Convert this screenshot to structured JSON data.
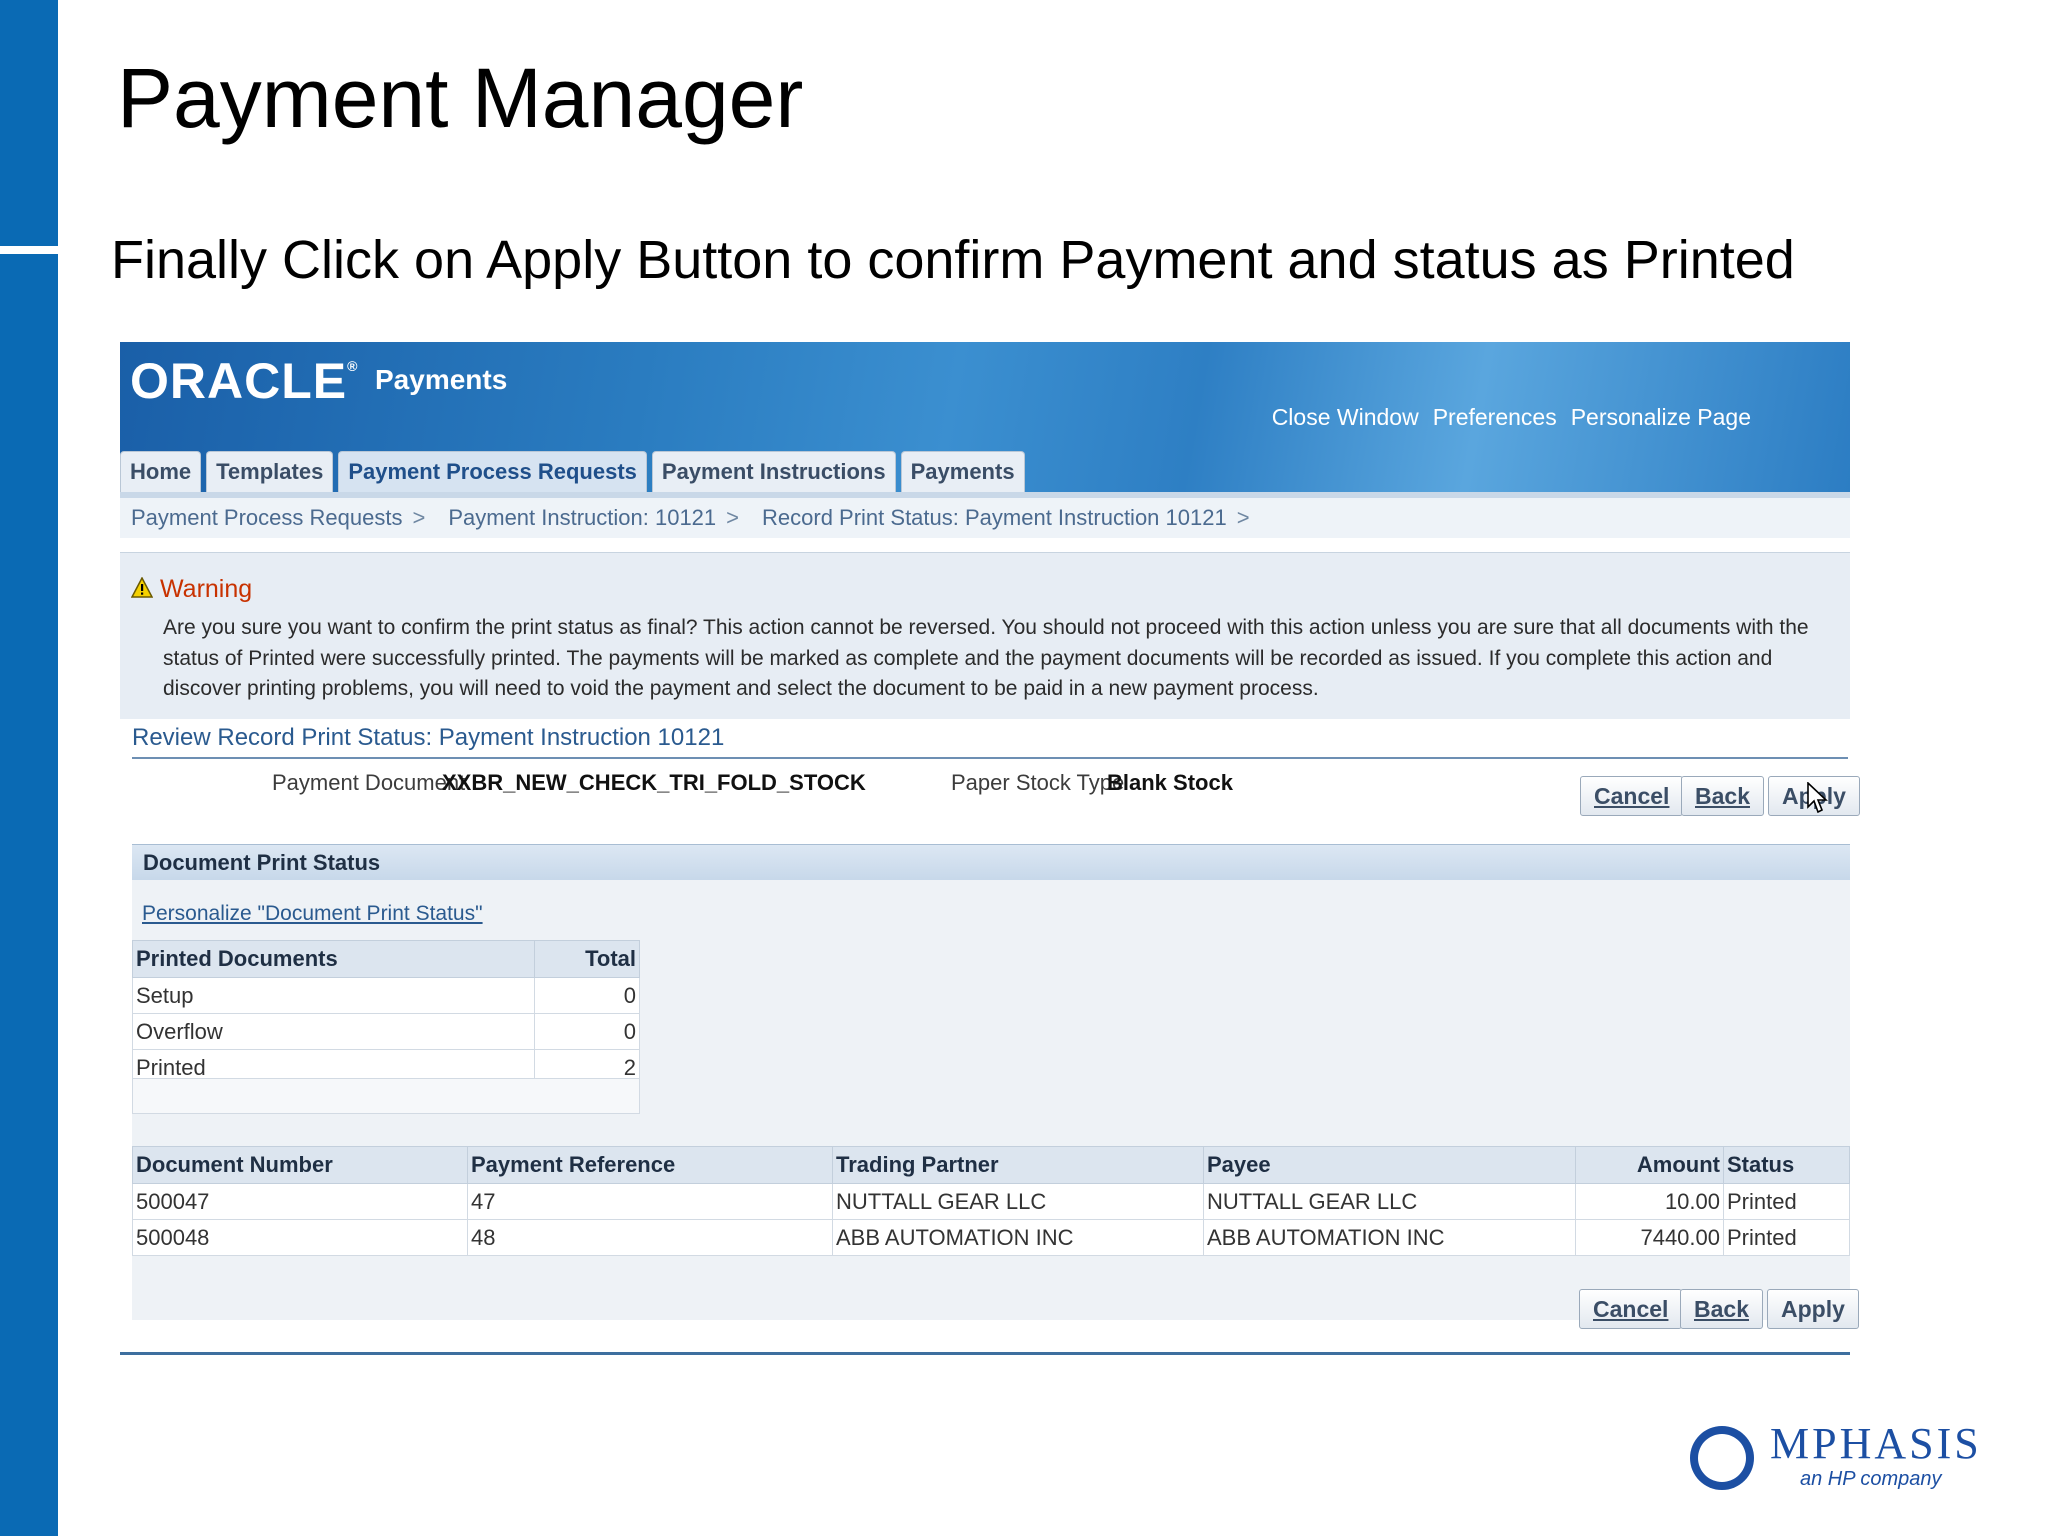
{
  "slide": {
    "title": "Payment Manager",
    "subtitle": "Finally Click on Apply Button to confirm Payment and status as Printed"
  },
  "app": {
    "logo": "ORACLE",
    "product": "Payments",
    "global_links": [
      "Close Window",
      "Preferences",
      "Personalize Page"
    ],
    "tabs": [
      {
        "label": "Home",
        "active": false
      },
      {
        "label": "Templates",
        "active": false
      },
      {
        "label": "Payment Process Requests",
        "active": true
      },
      {
        "label": "Payment Instructions",
        "active": false
      },
      {
        "label": "Payments",
        "active": false
      }
    ],
    "breadcrumbs": [
      "Payment Process Requests",
      "Payment Instruction: 10121",
      "Record Print Status: Payment Instruction 10121"
    ],
    "breadcrumb_separator": ">"
  },
  "warning": {
    "title": "Warning",
    "message": "Are you sure you want to confirm the print status as final? This action cannot be reversed. You should not proceed with this action unless you are sure that all documents with the status of Printed were successfully printed. The payments will be marked as complete and the payment documents will be recorded as issued. If you complete this action and discover printing problems, you will need to void the payment and select the document to be paid in a new payment process."
  },
  "review": {
    "title": "Review Record Print Status: Payment Instruction 10121",
    "payment_document_label": "Payment Document",
    "payment_document_value": "XXBR_NEW_CHECK_TRI_FOLD_STOCK",
    "paper_stock_label": "Paper Stock Type",
    "paper_stock_value": "Blank Stock"
  },
  "buttons": {
    "cancel": "Cancel",
    "back": "Back",
    "apply": "Apply"
  },
  "print_status": {
    "title": "Document Print Status",
    "personalize_link": "Personalize \"Document Print Status\"",
    "columns": [
      "Printed Documents",
      "Total"
    ],
    "rows": [
      {
        "name": "Setup",
        "total": "0"
      },
      {
        "name": "Overflow",
        "total": "0"
      },
      {
        "name": "Printed",
        "total": "2"
      }
    ]
  },
  "documents": {
    "columns": [
      "Document Number",
      "Payment Reference",
      "Trading Partner",
      "Payee",
      "Amount",
      "Status"
    ],
    "rows": [
      {
        "number": "500047",
        "reference": "47",
        "partner": "NUTTALL GEAR LLC",
        "payee": "NUTTALL GEAR LLC",
        "amount": "10.00",
        "status": "Printed"
      },
      {
        "number": "500048",
        "reference": "48",
        "partner": "ABB AUTOMATION INC",
        "payee": "ABB AUTOMATION INC",
        "amount": "7440.00",
        "status": "Printed"
      }
    ]
  },
  "footer": {
    "brand": "MPHASIS",
    "tagline": "an HP company"
  },
  "colors": {
    "sidebar": "#0a6ab4",
    "header": "#2a7cc0",
    "warning_title": "#c83200",
    "link": "#2a5a8f"
  }
}
